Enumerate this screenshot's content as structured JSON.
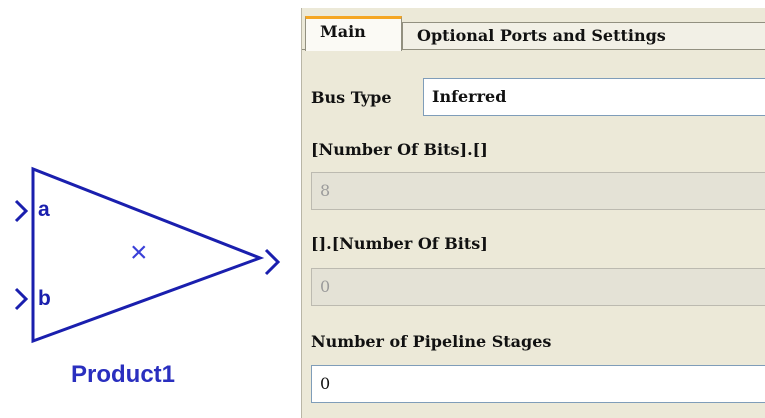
{
  "block": {
    "port_a": "a",
    "port_b": "b",
    "operator_symbol": "×",
    "name": "Product1",
    "color": "#2a2fbf"
  },
  "dialog": {
    "tabs": [
      {
        "label": "Main",
        "active": true
      },
      {
        "label": "Optional Ports and Settings",
        "active": false
      }
    ],
    "bus_type": {
      "label": "Bus Type",
      "value": "Inferred"
    },
    "bits_left": {
      "label": "[Number Of Bits].[]",
      "value": "8",
      "enabled": false
    },
    "bits_right": {
      "label": "[].[Number Of Bits]",
      "value": "0",
      "enabled": false
    },
    "pipeline": {
      "label": "Number of Pipeline Stages",
      "value": "0",
      "enabled": true
    }
  }
}
